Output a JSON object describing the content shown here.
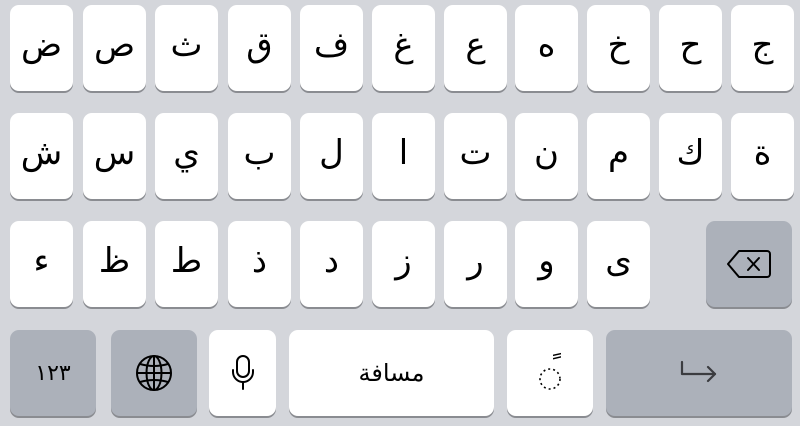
{
  "keyboard": {
    "row1": [
      "ض",
      "ص",
      "ث",
      "ق",
      "ف",
      "غ",
      "ع",
      "ه",
      "خ",
      "ح",
      "ج"
    ],
    "row2": [
      "ش",
      "س",
      "ي",
      "ب",
      "ل",
      "ا",
      "ت",
      "ن",
      "م",
      "ك",
      "ة"
    ],
    "row3": [
      "ء",
      "ظ",
      "ط",
      "ذ",
      "د",
      "ز",
      "ر",
      "و",
      "ى"
    ],
    "numbers_label": "١٢٣",
    "space_label": "مسافة",
    "tanween_label": "ً",
    "icons": {
      "delete": "backspace-icon",
      "globe": "globe-icon",
      "mic": "microphone-icon",
      "return": "return-icon"
    },
    "colors": {
      "background": "#d4d6db",
      "key": "#ffffff",
      "function_key": "#acb1ba"
    }
  }
}
